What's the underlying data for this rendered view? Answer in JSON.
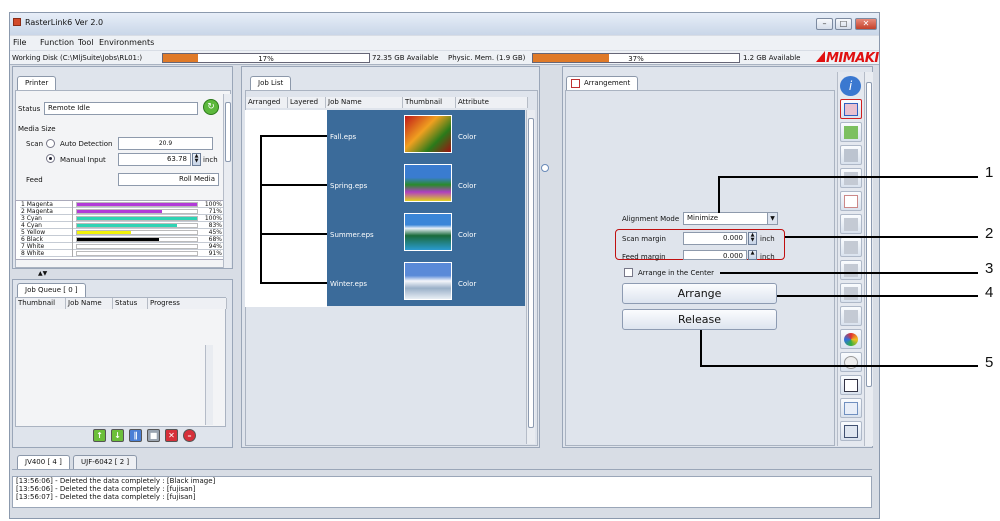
{
  "window": {
    "title": "RasterLink6 Ver 2.0",
    "minimize": "–",
    "maximize": "□",
    "close": "✕"
  },
  "menu": [
    "File",
    "Function",
    "Tool",
    "Environments"
  ],
  "disk": {
    "label": "Working Disk (C:\\MljSuite\\Jobs\\RL01:)",
    "percent_text": "17%",
    "fill": 0.17,
    "available": "72.35 GB Available",
    "mem_label": "Physic. Mem. (1.9 GB)",
    "mem_percent_text": "37%",
    "mem_fill": 0.37,
    "mem_available": "1.2 GB Available"
  },
  "logo": "MIMAKI",
  "printer": {
    "tab": "Printer",
    "status_label": "Status",
    "status_value": "Remote Idle",
    "media_size": "Media Size",
    "scan_label": "Scan",
    "auto_detection": "Auto Detection",
    "auto_value": "20.9",
    "manual_input": "Manual Input",
    "manual_value": "63.78",
    "unit": "inch",
    "feed_label": "Feed",
    "feed_value": "Roll Media",
    "inks": [
      {
        "name": "1 Magenta",
        "level": 1.0,
        "pct": "100%",
        "color": "#b23ad8"
      },
      {
        "name": "2 Magenta",
        "level": 0.71,
        "pct": "71%",
        "color": "#b23ad8"
      },
      {
        "name": "3 Cyan",
        "level": 1.0,
        "pct": "100%",
        "color": "#2fd3b4"
      },
      {
        "name": "4 Cyan",
        "level": 0.83,
        "pct": "83%",
        "color": "#2fd3b4"
      },
      {
        "name": "5 Yellow",
        "level": 0.45,
        "pct": "45%",
        "color": "#f2f20a"
      },
      {
        "name": "6 Black",
        "level": 0.68,
        "pct": "68%",
        "color": "#000000"
      },
      {
        "name": "7 White",
        "level": 0.94,
        "pct": "94%",
        "color": "#ffffff"
      },
      {
        "name": "8 White",
        "level": 0.91,
        "pct": "91%",
        "color": "#ffffff"
      }
    ]
  },
  "queue": {
    "tab": "Job Queue [ 0 ]",
    "columns": [
      "Thumbnail",
      "Job Name",
      "Status",
      "Progress"
    ]
  },
  "joblist": {
    "tab": "Job List",
    "columns": [
      "Arranged",
      "Layered",
      "Job Name",
      "Thumbnail",
      "Attribute"
    ],
    "rows": [
      {
        "name": "Fall.eps",
        "attr": "Color"
      },
      {
        "name": "Spring.eps",
        "attr": "Color"
      },
      {
        "name": "Summer.eps",
        "attr": "Color"
      },
      {
        "name": "Winter.eps",
        "attr": "Color"
      }
    ]
  },
  "arrangement": {
    "tab": "Arrangement",
    "mode_label": "Alignment Mode",
    "mode_value": "Minimize",
    "scan_margin_label": "Scan margin",
    "scan_margin_value": "0.000",
    "feed_margin_label": "Feed margin",
    "feed_margin_value": "0.000",
    "unit": "inch",
    "center_label": "Arrange in the Center",
    "arrange_btn": "Arrange",
    "release_btn": "Release"
  },
  "printer_tabs": [
    "JV400 [ 4 ]",
    "UJF-6042 [ 2 ]"
  ],
  "log": [
    "[13:56:06] - Deleted the data completely : [Black image]",
    "[13:56:06] - Deleted the data completely : [fujisan]",
    "[13:56:07] - Deleted the data completely : [fujisan]"
  ],
  "callouts": [
    "1",
    "2",
    "3",
    "4",
    "5"
  ]
}
